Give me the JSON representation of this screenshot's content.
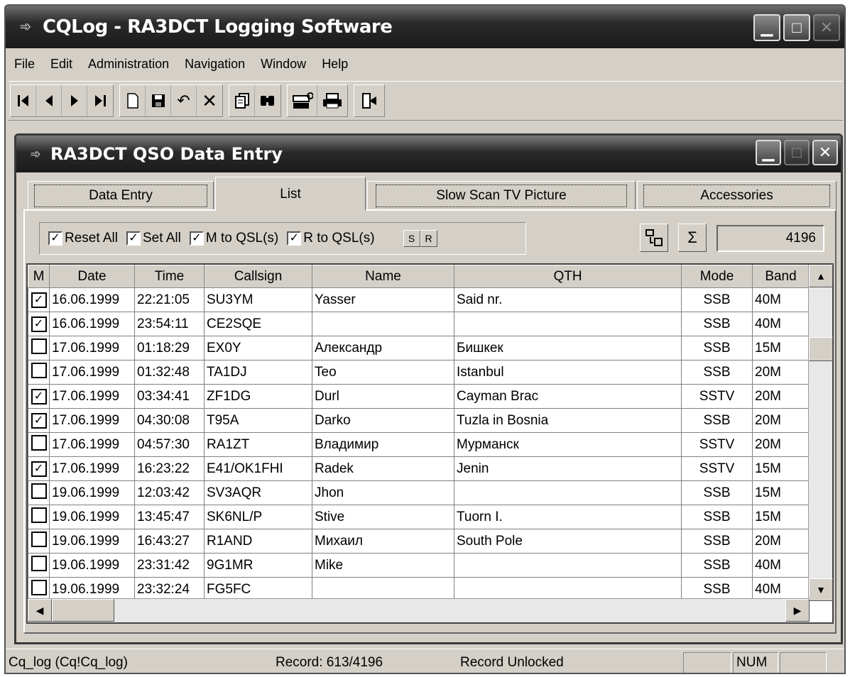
{
  "app": {
    "title": "CQLog - RA3DCT Logging Software",
    "window_buttons": [
      "minimize",
      "maximize",
      "close"
    ]
  },
  "menu": [
    "File",
    "Edit",
    "Administration",
    "Navigation",
    "Window",
    "Help"
  ],
  "toolbar": {
    "groups": [
      [
        "first-record-icon",
        "prev-record-icon",
        "next-record-icon",
        "last-record-icon"
      ],
      [
        "new-record-icon",
        "save-icon",
        "undo-icon",
        "delete-icon"
      ],
      [
        "copy-icon",
        "find-icon"
      ],
      [
        "tools-icon",
        "print-icon"
      ],
      [
        "exit-icon"
      ]
    ]
  },
  "child": {
    "title": "RA3DCT QSO Data Entry"
  },
  "tabs": [
    "Data Entry",
    "List",
    "Slow Scan TV Picture",
    "Accessories"
  ],
  "active_tab": "List",
  "filters": {
    "reset_all": "Reset All",
    "set_all": "Set All",
    "m_to_qsl": "M to QSL(s)",
    "r_to_qsl": "R to QSL(s)",
    "s_button": "S",
    "r_button": "R"
  },
  "count": "4196",
  "grid": {
    "columns": [
      "M",
      "Date",
      "Time",
      "Callsign",
      "Name",
      "QTH",
      "Mode",
      "Band"
    ],
    "rows": [
      {
        "m": true,
        "date": "16.06.1999",
        "time": "22:21:05",
        "callsign": "SU3YM",
        "name": "Yasser",
        "qth": "Said nr.",
        "mode": "SSB",
        "band": "40M"
      },
      {
        "m": true,
        "date": "16.06.1999",
        "time": "23:54:11",
        "callsign": "CE2SQE",
        "name": "",
        "qth": "",
        "mode": "SSB",
        "band": "40M"
      },
      {
        "m": false,
        "date": "17.06.1999",
        "time": "01:18:29",
        "callsign": "EX0Y",
        "name": "Александр",
        "qth": "Бишкек",
        "mode": "SSB",
        "band": "15M"
      },
      {
        "m": false,
        "date": "17.06.1999",
        "time": "01:32:48",
        "callsign": "TA1DJ",
        "name": "Teo",
        "qth": "Istanbul",
        "mode": "SSB",
        "band": "20M"
      },
      {
        "m": true,
        "date": "17.06.1999",
        "time": "03:34:41",
        "callsign": "ZF1DG",
        "name": "Durl",
        "qth": "Cayman Brac",
        "mode": "SSTV",
        "band": "20M"
      },
      {
        "m": true,
        "date": "17.06.1999",
        "time": "04:30:08",
        "callsign": "T95A",
        "name": "Darko",
        "qth": "Tuzla in Bosnia",
        "mode": "SSB",
        "band": "20M"
      },
      {
        "m": false,
        "date": "17.06.1999",
        "time": "04:57:30",
        "callsign": "RA1ZT",
        "name": "Владимир",
        "qth": "Мурманск",
        "mode": "SSTV",
        "band": "20M"
      },
      {
        "m": true,
        "date": "17.06.1999",
        "time": "16:23:22",
        "callsign": "E41/OK1FHI",
        "name": "Radek",
        "qth": "Jenin",
        "mode": "SSTV",
        "band": "15M"
      },
      {
        "m": false,
        "date": "19.06.1999",
        "time": "12:03:42",
        "callsign": "SV3AQR",
        "name": "Jhon",
        "qth": "",
        "mode": "SSB",
        "band": "15M"
      },
      {
        "m": false,
        "date": "19.06.1999",
        "time": "13:45:47",
        "callsign": "SK6NL/P",
        "name": "Stive",
        "qth": "Tuorn I.",
        "mode": "SSB",
        "band": "15M"
      },
      {
        "m": false,
        "date": "19.06.1999",
        "time": "16:43:27",
        "callsign": "R1AND",
        "name": "Михаил",
        "qth": "South Pole",
        "mode": "SSB",
        "band": "20M"
      },
      {
        "m": false,
        "date": "19.06.1999",
        "time": "23:31:42",
        "callsign": "9G1MR",
        "name": "Mike",
        "qth": "",
        "mode": "SSB",
        "band": "40M"
      },
      {
        "m": false,
        "date": "19.06.1999",
        "time": "23:32:24",
        "callsign": "FG5FC",
        "name": "",
        "qth": "",
        "mode": "SSB",
        "band": "40M"
      }
    ]
  },
  "status": {
    "database": "Cq_log (Cq!Cq_log)",
    "record": "Record: 613/4196",
    "lock": "Record Unlocked",
    "num": "NUM"
  }
}
